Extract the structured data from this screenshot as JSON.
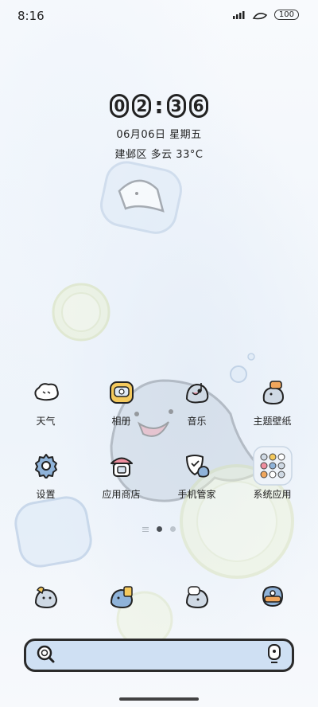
{
  "status_bar": {
    "time": "8:16",
    "battery": "100"
  },
  "clock": {
    "digits": [
      "0",
      "2",
      "3",
      "6"
    ],
    "date": "06月06日 星期五",
    "weather": "建邺区 多云 33°C"
  },
  "apps": [
    {
      "label": "天气",
      "icon": "weather-cloud-icon"
    },
    {
      "label": "相册",
      "icon": "gallery-icon"
    },
    {
      "label": "音乐",
      "icon": "music-seal-icon"
    },
    {
      "label": "主题壁纸",
      "icon": "theme-seal-icon"
    },
    {
      "label": "设置",
      "icon": "gear-icon"
    },
    {
      "label": "应用商店",
      "icon": "app-store-house-icon"
    },
    {
      "label": "手机管家",
      "icon": "shield-seal-icon"
    },
    {
      "label": "系统应用",
      "icon": "folder-icon"
    }
  ],
  "dock": [
    {
      "icon": "phone-seal-icon"
    },
    {
      "icon": "contacts-seal-icon"
    },
    {
      "icon": "messages-seal-icon"
    },
    {
      "icon": "camera-icon"
    }
  ],
  "search": {
    "left_icon": "search-icon",
    "right_icon": "mic-icon"
  },
  "colors": {
    "accent_blue": "#cfe0f3",
    "outline": "#2b2b2b"
  }
}
